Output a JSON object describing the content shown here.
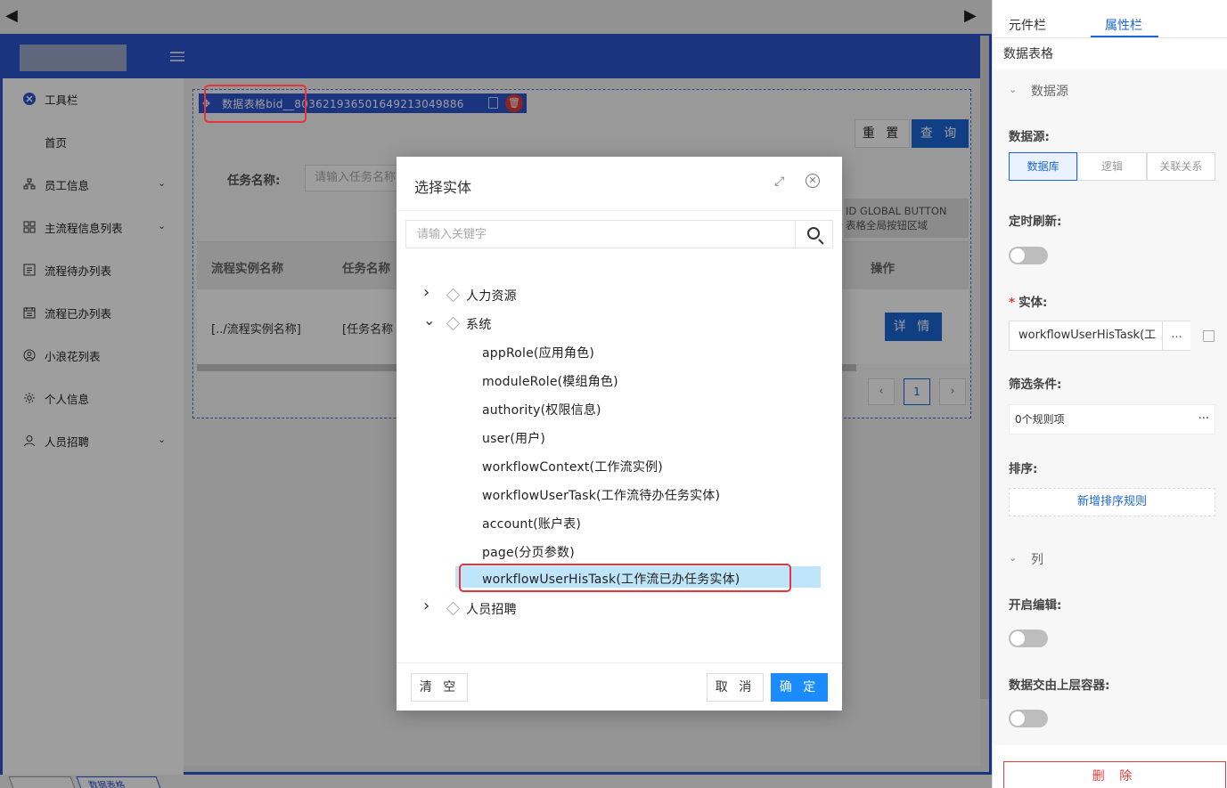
{
  "topbar": {
    "left_arrow": "◀",
    "right_arrow": "▶"
  },
  "sidebar": {
    "items": [
      {
        "label": "工具栏",
        "icon": "plugin-icon",
        "chevron": ""
      },
      {
        "label": "首页",
        "icon": "",
        "chevron": ""
      },
      {
        "label": "员工信息",
        "icon": "org-tree-icon",
        "chevron": "⌄"
      },
      {
        "label": "主流程信息列表",
        "icon": "grid-icon",
        "chevron": "⌄"
      },
      {
        "label": "流程待办列表",
        "icon": "list-icon",
        "chevron": ""
      },
      {
        "label": "流程已办列表",
        "icon": "calendar-icon",
        "chevron": ""
      },
      {
        "label": "小浪花列表",
        "icon": "user-circle-icon",
        "chevron": ""
      },
      {
        "label": "个人信息",
        "icon": "gear-icon",
        "chevron": ""
      },
      {
        "label": "人员招聘",
        "icon": "person-icon",
        "chevron": "⌄"
      }
    ]
  },
  "table_comp": {
    "tag_name": "数据表格bid__803621936501649213049886",
    "reset_label": "重 置",
    "query_label": "查 询",
    "filter_label": "任务名称:",
    "filter_placeholder": "请输入任务名称",
    "global_btn_line1": "ID GLOBAL BUTTON",
    "global_btn_line2": "表格全局按钮区域",
    "columns": [
      "流程实例名称",
      "任务名称",
      "操作"
    ],
    "row": {
      "col1": "[../流程实例名称]",
      "col2": "[任务名称",
      "action": "详 情"
    },
    "pager": {
      "prev": "‹",
      "page": "1",
      "next": "›"
    }
  },
  "bottom_tabs": [
    "",
    "数据表格"
  ],
  "rpanel": {
    "tab_components": "元件栏",
    "tab_properties": "属性栏",
    "title": "数据表格",
    "sec_datasource": "数据源",
    "label_datasource": "数据源:",
    "seg": [
      "数据库",
      "逻辑",
      "关联关系"
    ],
    "label_timer": "定时刷新:",
    "label_entity": "实体:",
    "required_mark": "*",
    "entity_value": "workflowUserHisTask(工",
    "entity_more": "...",
    "label_filter": "筛选条件:",
    "filter_value": "0个规则项",
    "filter_more": "···",
    "label_sort": "排序:",
    "sort_btn": "新增排序规则",
    "sec_columns": "列",
    "label_edit": "开启编辑:",
    "label_parent": "数据交由上层容器:",
    "delete_btn": "删 除"
  },
  "modal": {
    "title": "选择实体",
    "search_placeholder": "请输入关键字",
    "tree": [
      {
        "label": "人力资源",
        "level": 0,
        "expanded": false
      },
      {
        "label": "系统",
        "level": 0,
        "expanded": true
      },
      {
        "label": "appRole(应用角色)",
        "level": 1
      },
      {
        "label": "moduleRole(模组角色)",
        "level": 1
      },
      {
        "label": "authority(权限信息)",
        "level": 1
      },
      {
        "label": "user(用户)",
        "level": 1
      },
      {
        "label": "workflowContext(工作流实例)",
        "level": 1
      },
      {
        "label": "workflowUserTask(工作流待办任务实体)",
        "level": 1
      },
      {
        "label": "account(账户表)",
        "level": 1
      },
      {
        "label": "page(分页参数)",
        "level": 1
      },
      {
        "label": "workflowUserHisTask(工作流已办任务实体)",
        "level": 1,
        "selected": true
      },
      {
        "label": "人员招聘",
        "level": 0,
        "expanded": false
      }
    ],
    "clear_label": "清 空",
    "cancel_label": "取 消",
    "ok_label": "确 定"
  },
  "colors": {
    "primary": "#2b55cf",
    "accent": "#1a66d4",
    "ok": "#1a8cff",
    "danger": "#e23b3b",
    "selected_bg": "#bfe5fb"
  }
}
